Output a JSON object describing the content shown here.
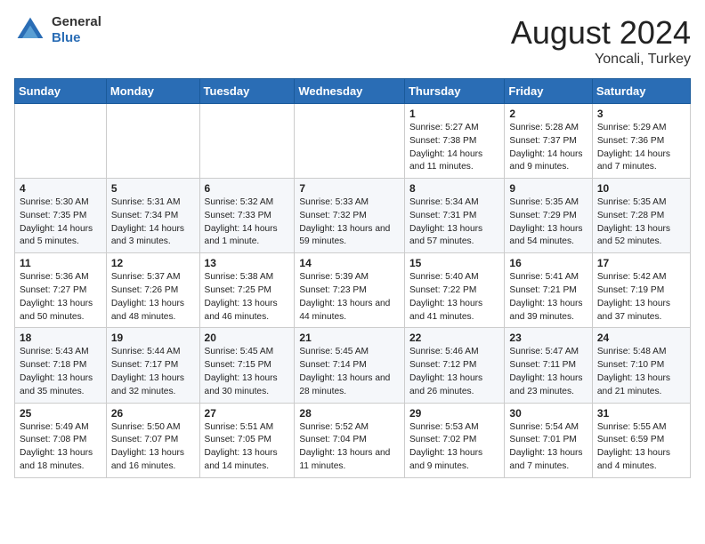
{
  "header": {
    "logo_general": "General",
    "logo_blue": "Blue",
    "title": "August 2024",
    "subtitle": "Yoncali, Turkey"
  },
  "weekdays": [
    "Sunday",
    "Monday",
    "Tuesday",
    "Wednesday",
    "Thursday",
    "Friday",
    "Saturday"
  ],
  "weeks": [
    [
      {
        "day": "",
        "info": ""
      },
      {
        "day": "",
        "info": ""
      },
      {
        "day": "",
        "info": ""
      },
      {
        "day": "",
        "info": ""
      },
      {
        "day": "1",
        "info": "Sunrise: 5:27 AM\nSunset: 7:38 PM\nDaylight: 14 hours\nand 11 minutes."
      },
      {
        "day": "2",
        "info": "Sunrise: 5:28 AM\nSunset: 7:37 PM\nDaylight: 14 hours\nand 9 minutes."
      },
      {
        "day": "3",
        "info": "Sunrise: 5:29 AM\nSunset: 7:36 PM\nDaylight: 14 hours\nand 7 minutes."
      }
    ],
    [
      {
        "day": "4",
        "info": "Sunrise: 5:30 AM\nSunset: 7:35 PM\nDaylight: 14 hours\nand 5 minutes."
      },
      {
        "day": "5",
        "info": "Sunrise: 5:31 AM\nSunset: 7:34 PM\nDaylight: 14 hours\nand 3 minutes."
      },
      {
        "day": "6",
        "info": "Sunrise: 5:32 AM\nSunset: 7:33 PM\nDaylight: 14 hours\nand 1 minute."
      },
      {
        "day": "7",
        "info": "Sunrise: 5:33 AM\nSunset: 7:32 PM\nDaylight: 13 hours\nand 59 minutes."
      },
      {
        "day": "8",
        "info": "Sunrise: 5:34 AM\nSunset: 7:31 PM\nDaylight: 13 hours\nand 57 minutes."
      },
      {
        "day": "9",
        "info": "Sunrise: 5:35 AM\nSunset: 7:29 PM\nDaylight: 13 hours\nand 54 minutes."
      },
      {
        "day": "10",
        "info": "Sunrise: 5:35 AM\nSunset: 7:28 PM\nDaylight: 13 hours\nand 52 minutes."
      }
    ],
    [
      {
        "day": "11",
        "info": "Sunrise: 5:36 AM\nSunset: 7:27 PM\nDaylight: 13 hours\nand 50 minutes."
      },
      {
        "day": "12",
        "info": "Sunrise: 5:37 AM\nSunset: 7:26 PM\nDaylight: 13 hours\nand 48 minutes."
      },
      {
        "day": "13",
        "info": "Sunrise: 5:38 AM\nSunset: 7:25 PM\nDaylight: 13 hours\nand 46 minutes."
      },
      {
        "day": "14",
        "info": "Sunrise: 5:39 AM\nSunset: 7:23 PM\nDaylight: 13 hours\nand 44 minutes."
      },
      {
        "day": "15",
        "info": "Sunrise: 5:40 AM\nSunset: 7:22 PM\nDaylight: 13 hours\nand 41 minutes."
      },
      {
        "day": "16",
        "info": "Sunrise: 5:41 AM\nSunset: 7:21 PM\nDaylight: 13 hours\nand 39 minutes."
      },
      {
        "day": "17",
        "info": "Sunrise: 5:42 AM\nSunset: 7:19 PM\nDaylight: 13 hours\nand 37 minutes."
      }
    ],
    [
      {
        "day": "18",
        "info": "Sunrise: 5:43 AM\nSunset: 7:18 PM\nDaylight: 13 hours\nand 35 minutes."
      },
      {
        "day": "19",
        "info": "Sunrise: 5:44 AM\nSunset: 7:17 PM\nDaylight: 13 hours\nand 32 minutes."
      },
      {
        "day": "20",
        "info": "Sunrise: 5:45 AM\nSunset: 7:15 PM\nDaylight: 13 hours\nand 30 minutes."
      },
      {
        "day": "21",
        "info": "Sunrise: 5:45 AM\nSunset: 7:14 PM\nDaylight: 13 hours\nand 28 minutes."
      },
      {
        "day": "22",
        "info": "Sunrise: 5:46 AM\nSunset: 7:12 PM\nDaylight: 13 hours\nand 26 minutes."
      },
      {
        "day": "23",
        "info": "Sunrise: 5:47 AM\nSunset: 7:11 PM\nDaylight: 13 hours\nand 23 minutes."
      },
      {
        "day": "24",
        "info": "Sunrise: 5:48 AM\nSunset: 7:10 PM\nDaylight: 13 hours\nand 21 minutes."
      }
    ],
    [
      {
        "day": "25",
        "info": "Sunrise: 5:49 AM\nSunset: 7:08 PM\nDaylight: 13 hours\nand 18 minutes."
      },
      {
        "day": "26",
        "info": "Sunrise: 5:50 AM\nSunset: 7:07 PM\nDaylight: 13 hours\nand 16 minutes."
      },
      {
        "day": "27",
        "info": "Sunrise: 5:51 AM\nSunset: 7:05 PM\nDaylight: 13 hours\nand 14 minutes."
      },
      {
        "day": "28",
        "info": "Sunrise: 5:52 AM\nSunset: 7:04 PM\nDaylight: 13 hours\nand 11 minutes."
      },
      {
        "day": "29",
        "info": "Sunrise: 5:53 AM\nSunset: 7:02 PM\nDaylight: 13 hours\nand 9 minutes."
      },
      {
        "day": "30",
        "info": "Sunrise: 5:54 AM\nSunset: 7:01 PM\nDaylight: 13 hours\nand 7 minutes."
      },
      {
        "day": "31",
        "info": "Sunrise: 5:55 AM\nSunset: 6:59 PM\nDaylight: 13 hours\nand 4 minutes."
      }
    ]
  ]
}
